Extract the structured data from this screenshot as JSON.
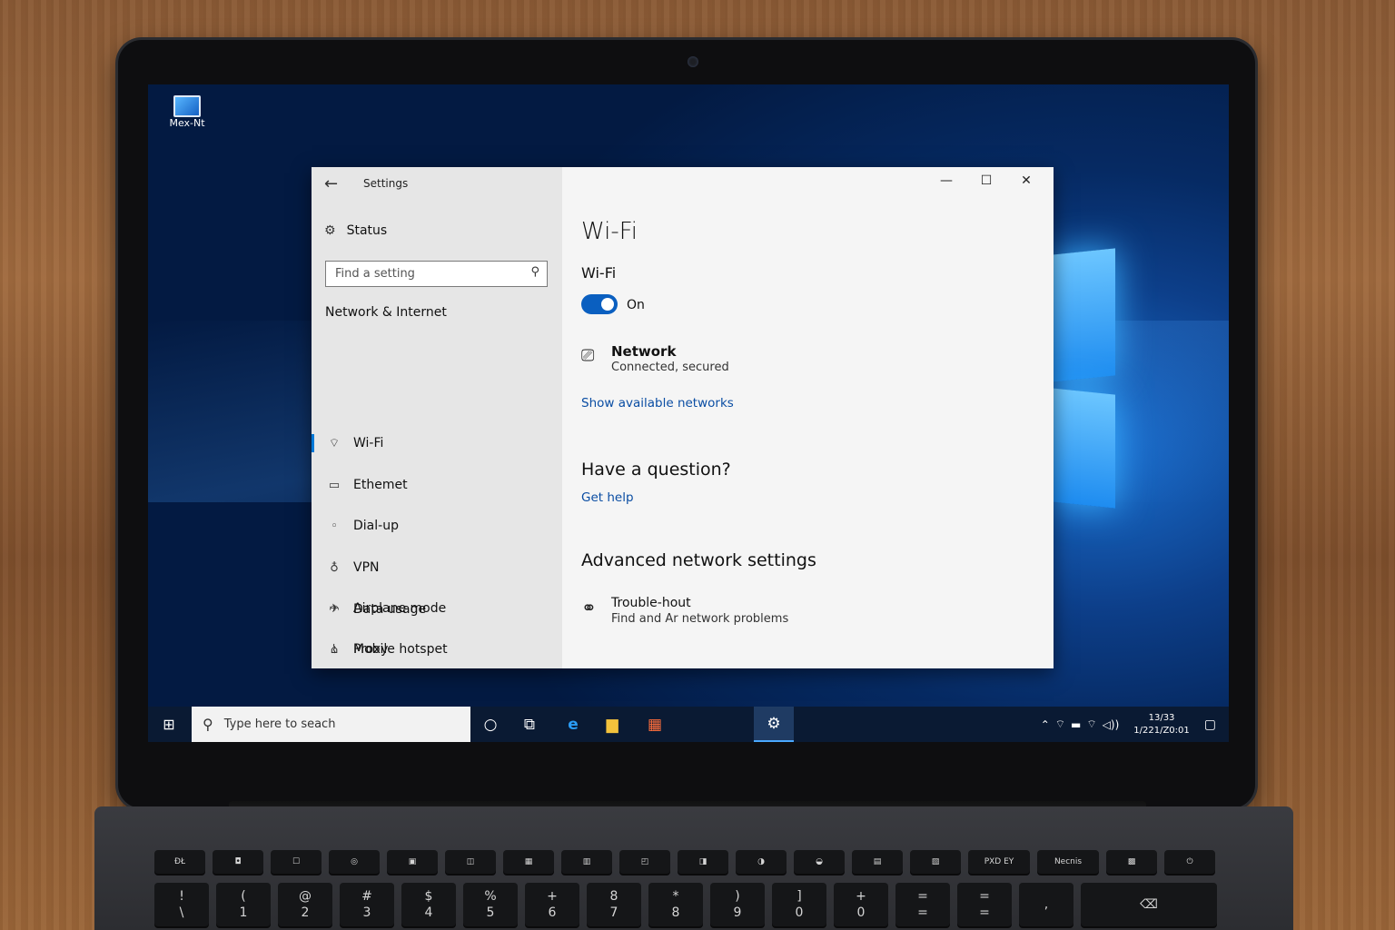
{
  "desktop": {
    "icon_label": "Mex-Nt"
  },
  "window": {
    "app_title": "Settings",
    "controls": {
      "minimize": "—",
      "maximize": "☐",
      "close": "✕"
    }
  },
  "sidebar": {
    "status_label": "Status",
    "search_placeholder": "Find a setting",
    "section_title": "Network & Internet",
    "items": [
      {
        "label": "Wi-Fi",
        "icon": "wifi-icon",
        "active": true
      },
      {
        "label": "Ethemet",
        "icon": "ethernet-icon",
        "active": false
      },
      {
        "label": "Dial-up",
        "icon": "dialup-icon",
        "active": false
      },
      {
        "label": "VPN",
        "icon": "vpn-icon",
        "active": false
      },
      {
        "label": "Airplane mode",
        "icon": "airplane-icon",
        "active": false
      },
      {
        "label": "Mobile hotspet",
        "icon": "hotspot-icon",
        "active": false
      },
      {
        "label": "Data usage",
        "icon": "data-usage-icon",
        "active": false
      },
      {
        "label": "Proxy",
        "icon": "proxy-icon",
        "active": false
      }
    ]
  },
  "content": {
    "page_title": "Wi-Fi",
    "wifi_subtitle": "Wi-Fi",
    "toggle_state": "On",
    "network": {
      "name": "Network",
      "status": "Connected, secured"
    },
    "show_networks_link": "Show available networks",
    "question_heading": "Have a question?",
    "get_help_link": "Get help",
    "advanced_heading": "Advanced network settings",
    "troubleshoot": {
      "title": "Trouble-hout",
      "description": "Find and Ar network problems"
    }
  },
  "taskbar": {
    "search_placeholder": "Type here to seach",
    "clock": {
      "time": "13/33",
      "date": "1/221/Z0:01"
    }
  },
  "colors": {
    "accent": "#0078d7",
    "link": "#0a4da3",
    "toggle": "#0a5fc0",
    "taskbar": "#0a1a33"
  },
  "keyboard": {
    "fn_row": [
      "ĐŁ",
      "◘",
      "☐",
      "◎",
      "▣",
      "◫",
      "▦",
      "▥",
      "◰",
      "◨",
      "◑",
      "◒",
      "▤",
      "▧",
      "PXD EY",
      "Necnis",
      "▩",
      "⏻"
    ],
    "num_row": [
      {
        "top": "!",
        "bottom": "\\"
      },
      {
        "top": "(",
        "bottom": "1"
      },
      {
        "top": "@",
        "bottom": "2"
      },
      {
        "top": "#",
        "bottom": "3"
      },
      {
        "top": "$",
        "bottom": "4"
      },
      {
        "top": "%",
        "bottom": "5"
      },
      {
        "top": "+",
        "bottom": "6"
      },
      {
        "top": "8",
        "bottom": "7"
      },
      {
        "top": "*",
        "bottom": "8"
      },
      {
        "top": ")",
        "bottom": "9"
      },
      {
        "top": "]",
        "bottom": "0"
      },
      {
        "top": "+",
        "bottom": "0"
      },
      {
        "top": "=",
        "bottom": "="
      },
      {
        "top": "=",
        "bottom": "="
      },
      {
        "top": "",
        "bottom": ","
      },
      {
        "top": "",
        "bottom": "⌫"
      }
    ]
  }
}
